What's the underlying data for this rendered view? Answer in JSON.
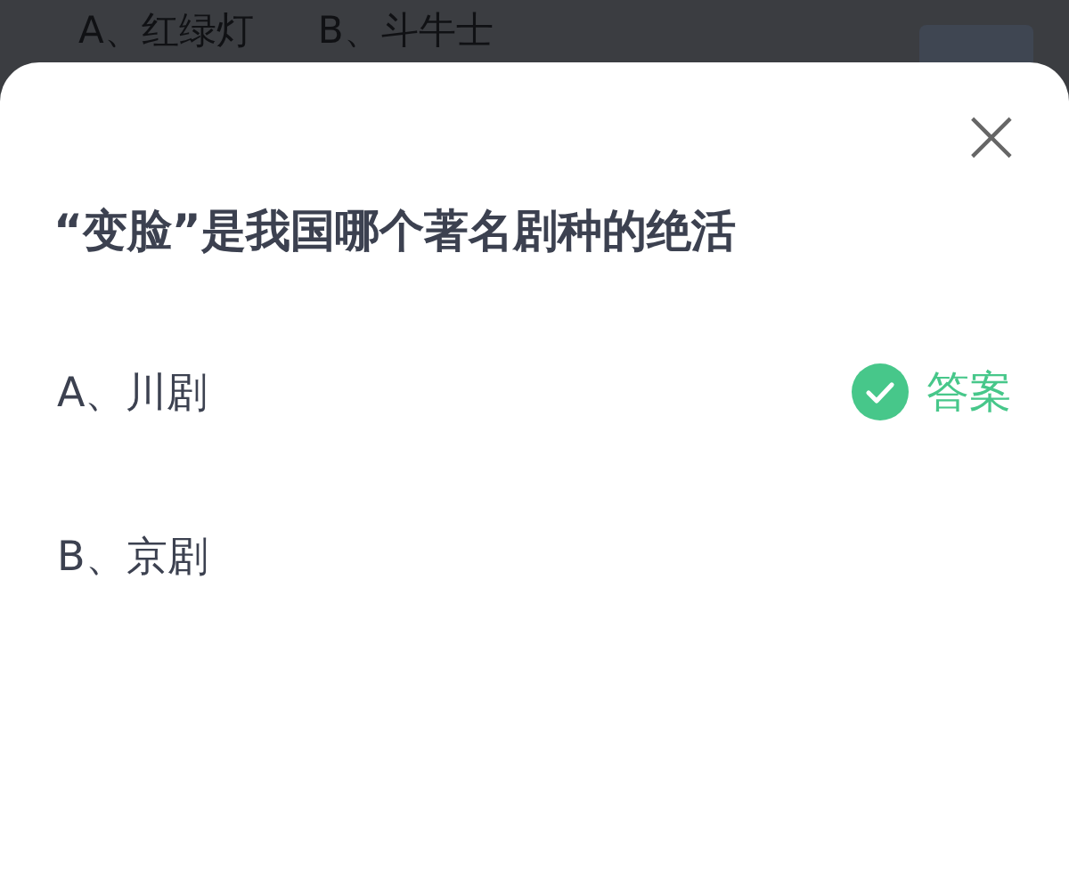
{
  "background_question": {
    "options": [
      "A、红绿灯",
      "B、斗牛士"
    ]
  },
  "sheet": {
    "close_icon": "×",
    "question": "“变脸”是我国哪个著名剧种的绝活",
    "answer_label": "答案",
    "options": [
      {
        "label": "A、川剧",
        "correct": true
      },
      {
        "label": "B、京剧",
        "correct": false
      }
    ]
  }
}
